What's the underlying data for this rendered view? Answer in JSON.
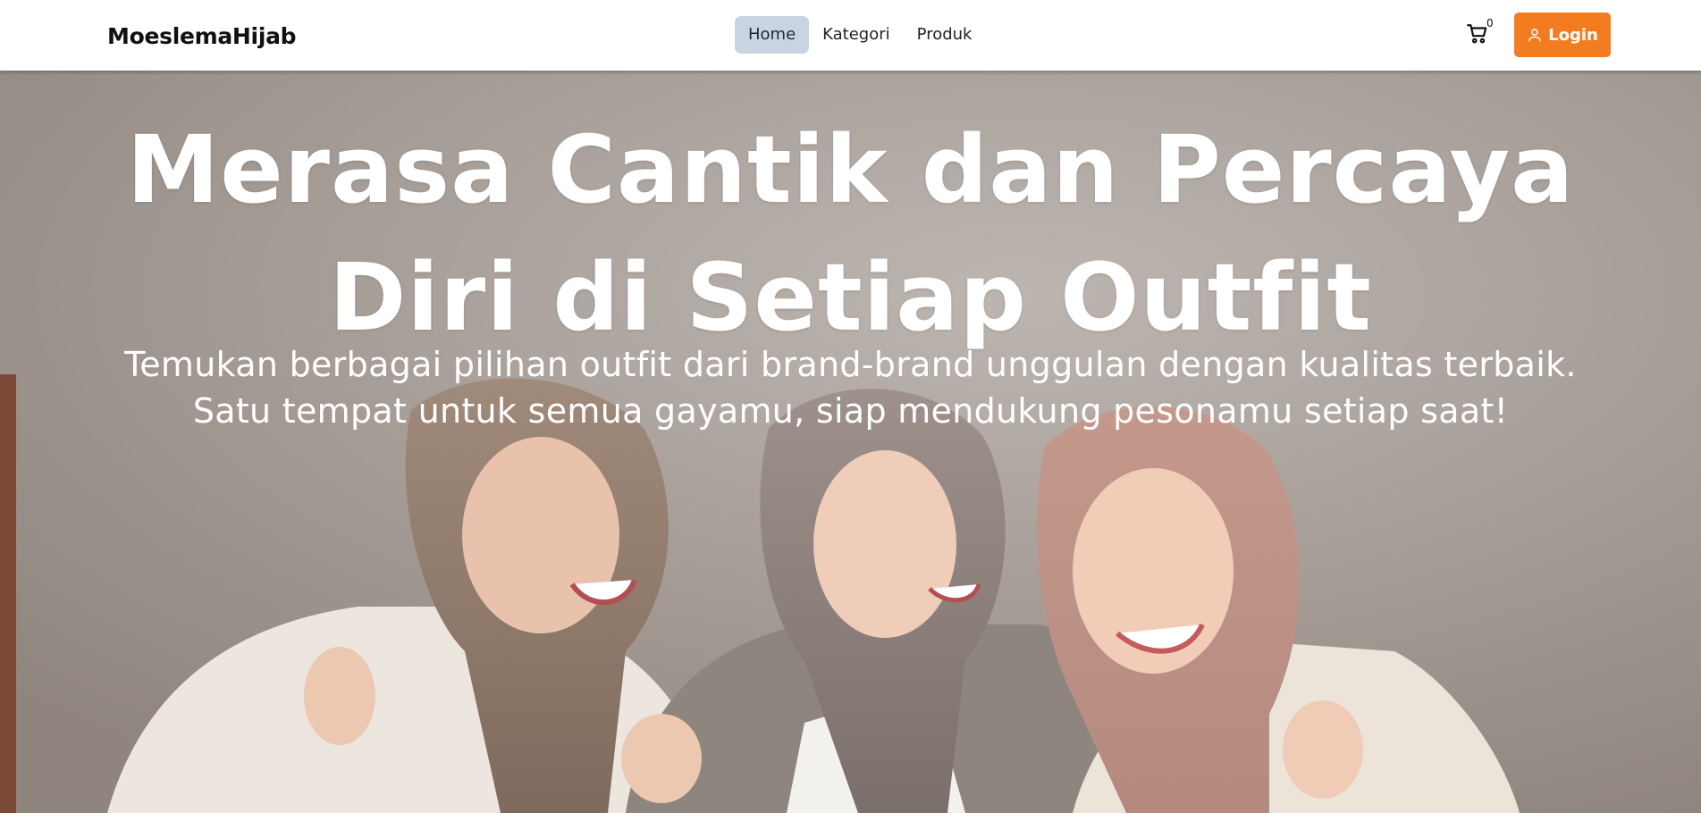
{
  "navbar": {
    "brand": "MoeslemaHijab",
    "links": [
      {
        "label": "Home",
        "active": true
      },
      {
        "label": "Kategori",
        "active": false
      },
      {
        "label": "Produk",
        "active": false
      }
    ],
    "cart": {
      "icon": "cart-icon",
      "count": "0"
    },
    "login": {
      "icon": "user-icon",
      "label": "Login"
    },
    "colors": {
      "accent": "#f47c20",
      "active_link_bg": "#c9d4e3"
    }
  },
  "hero": {
    "title_line1": "Merasa Cantik dan Percaya",
    "title_line2": "Diri di Setiap Outfit",
    "subtitle_line1": "Temukan berbagai pilihan outfit dari brand-brand unggulan dengan kualitas terbaik.",
    "subtitle_line2": "Satu tempat untuk semua gayamu, siap mendukung pesonamu setiap saat!"
  }
}
